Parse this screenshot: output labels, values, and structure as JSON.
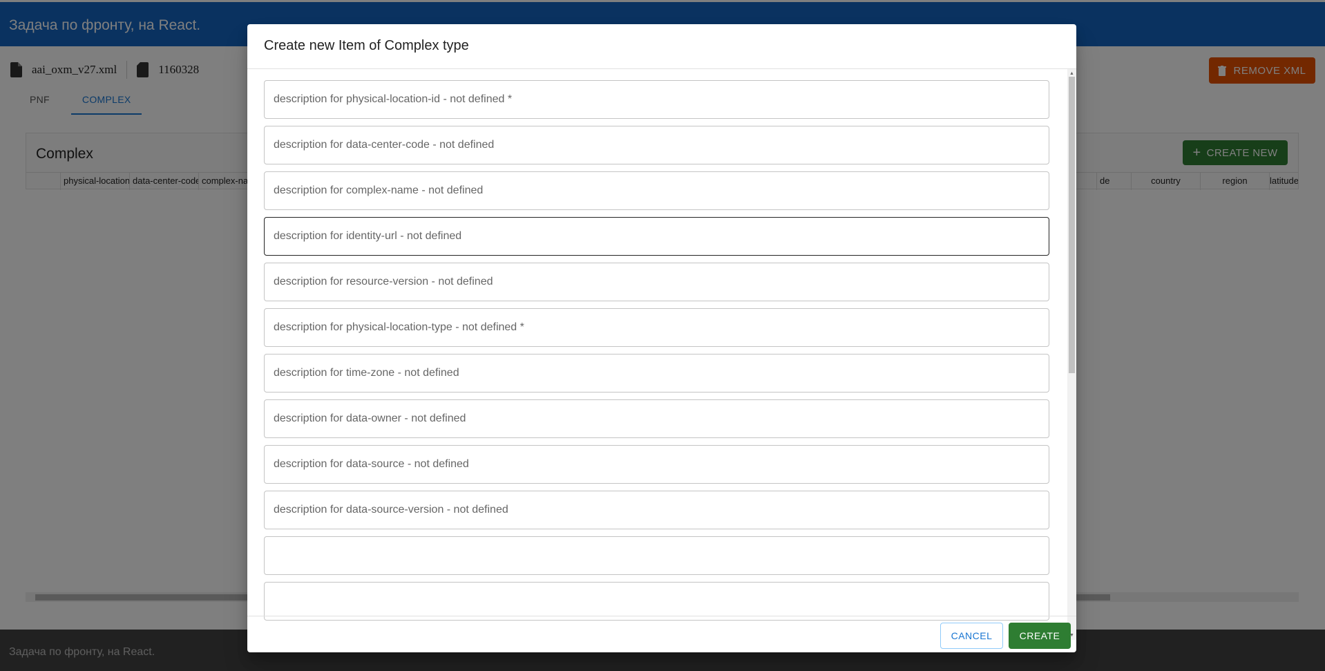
{
  "app": {
    "title": "Задача по фронту, на React."
  },
  "file": {
    "name": "aai_oxm_v27.xml",
    "size": "1160328"
  },
  "toolbar": {
    "remove_label": "REMOVE XML"
  },
  "tabs": [
    {
      "label": "PNF"
    },
    {
      "label": "COMPLEX"
    }
  ],
  "panel": {
    "title": "Complex",
    "create_label": "CREATE NEW",
    "columns": [
      "",
      "physical-location",
      "data-center-code",
      "complex-na",
      "de",
      "country",
      "region",
      "latitude"
    ]
  },
  "footer": {
    "text": "Задача по фронту, на React."
  },
  "dialog": {
    "title": "Create new Item of Complex type",
    "fields": [
      {
        "label": "description for physical-location-id - not defined *"
      },
      {
        "label": "description for data-center-code - not defined"
      },
      {
        "label": "description for complex-name - not defined"
      },
      {
        "label": "description for identity-url - not defined"
      },
      {
        "label": "description for resource-version - not defined"
      },
      {
        "label": "description for physical-location-type - not defined *"
      },
      {
        "label": "description for time-zone - not defined"
      },
      {
        "label": "description for data-owner - not defined"
      },
      {
        "label": "description for data-source - not defined"
      },
      {
        "label": "description for data-source-version - not defined"
      },
      {
        "label": ""
      },
      {
        "label": ""
      }
    ],
    "cancel_label": "CANCEL",
    "create_label": "CREATE"
  },
  "colors": {
    "primary": "#1565c0",
    "success": "#2e7d32",
    "warning": "#e65100",
    "link": "#1976d2"
  }
}
